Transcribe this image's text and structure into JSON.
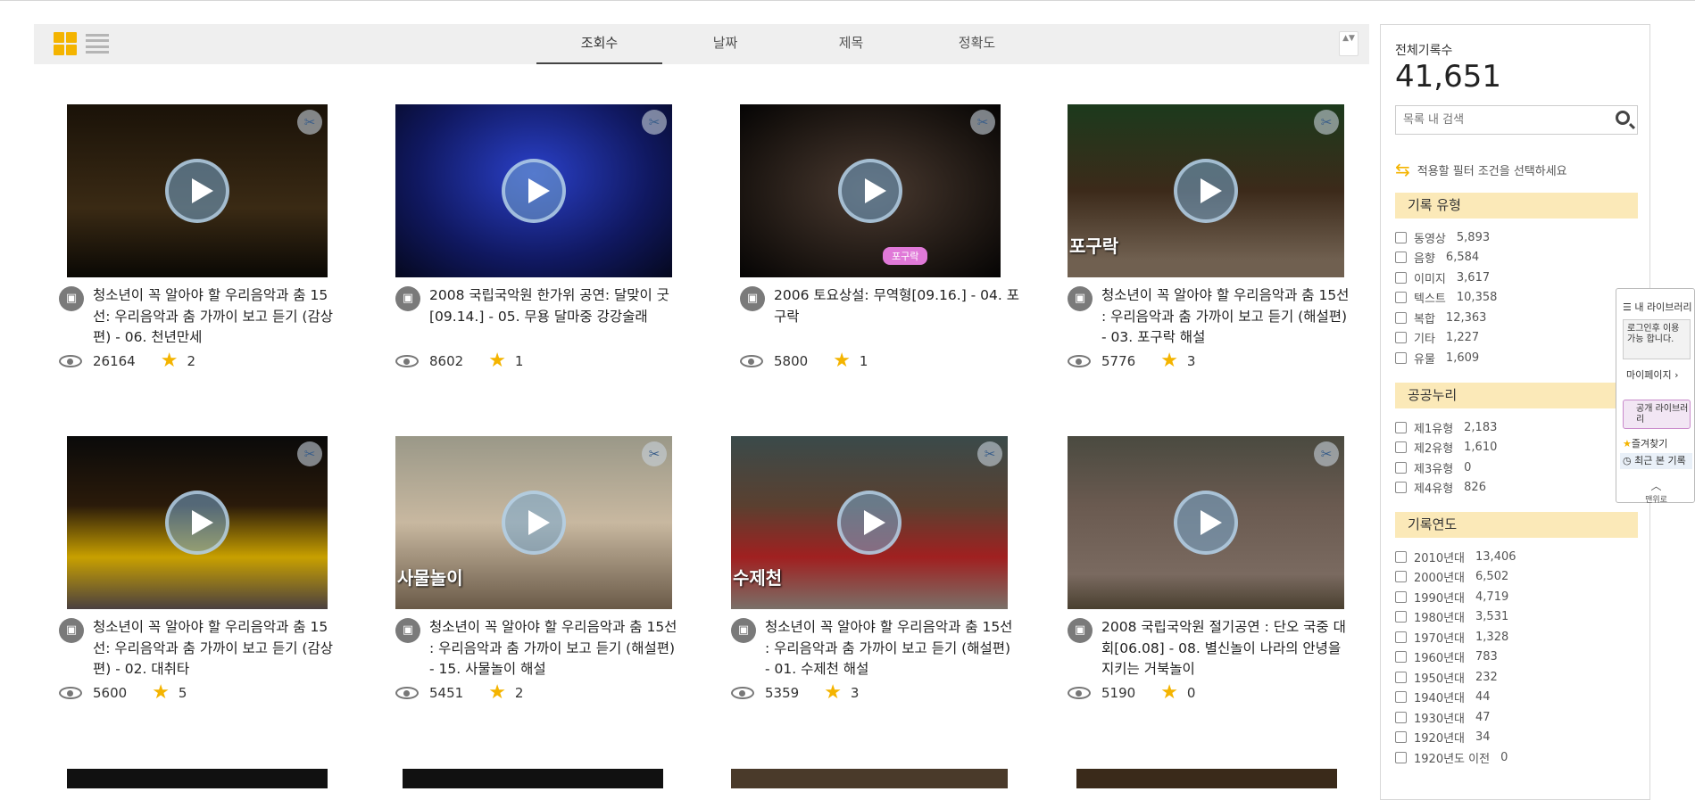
{
  "sort": {
    "tabs": [
      "조회수",
      "날짜",
      "제목",
      "정확도"
    ],
    "active": 0,
    "arrows": "▲▼"
  },
  "cards": [
    {
      "title": "청소년이 꼭 알아야 할 우리음악과 춤 15선: 우리음악과 춤 가까이 보고 듣기 (감상편) - 06. 천년만세",
      "views": "26164",
      "stars": "2",
      "overlay": ""
    },
    {
      "title": "2008 국립국악원 한가위 공연: 달맞이 굿[09.14.] - 05. 무용 달마중 강강술래",
      "views": "8602",
      "stars": "1",
      "overlay": ""
    },
    {
      "title": "2006 토요상설: 무역형[09.16.] - 04. 포구락",
      "views": "5800",
      "stars": "1",
      "overlay": ""
    },
    {
      "title": "청소년이 꼭 알아야 할 우리음악과 춤 15선 : 우리음악과 춤 가까이 보고 듣기 (해설편) - 03. 포구락 해설",
      "views": "5776",
      "stars": "3",
      "overlay": "포구락"
    },
    {
      "title": "청소년이 꼭 알아야 할 우리음악과 춤 15선: 우리음악과 춤 가까이 보고 듣기 (감상편) - 02. 대취타",
      "views": "5600",
      "stars": "5",
      "overlay": ""
    },
    {
      "title": "청소년이 꼭 알아야 할 우리음악과 춤 15선 : 우리음악과 춤 가까이 보고 듣기 (해설편) - 15. 사물놀이 해설",
      "views": "5451",
      "stars": "2",
      "overlay": "사물놀이"
    },
    {
      "title": "청소년이 꼭 알아야 할 우리음악과 춤 15선 : 우리음악과 춤 가까이 보고 듣기 (해설편) - 01. 수제천 해설",
      "views": "5359",
      "stars": "3",
      "overlay": "수제천"
    },
    {
      "title": "2008 국립국악원 절기공연 : 단오 국중 대회[06.08] - 08. 별신놀이 나라의 안녕을 지키는 거북놀이",
      "views": "5190",
      "stars": "0",
      "overlay": ""
    }
  ],
  "thumb_badge": "포구락",
  "sidebar": {
    "total_label": "전체기록수",
    "total_count": "41,651",
    "search_placeholder": "목록 내 검색",
    "filter_hint": "적용할 필터 조건을 선택하세요",
    "sections": [
      {
        "title": "기록 유형",
        "options": [
          {
            "label": "동영상",
            "count": "5,893"
          },
          {
            "label": "음향",
            "count": "6,584"
          },
          {
            "label": "이미지",
            "count": "3,617"
          },
          {
            "label": "텍스트",
            "count": "10,358"
          },
          {
            "label": "복합",
            "count": "12,363"
          },
          {
            "label": "기타",
            "count": "1,227"
          },
          {
            "label": "유물",
            "count": "1,609"
          }
        ]
      },
      {
        "title": "공공누리",
        "options": [
          {
            "label": "제1유형",
            "count": "2,183"
          },
          {
            "label": "제2유형",
            "count": "1,610"
          },
          {
            "label": "제3유형",
            "count": "0"
          },
          {
            "label": "제4유형",
            "count": "826"
          }
        ]
      },
      {
        "title": "기록연도",
        "options": [
          {
            "label": "2010년대",
            "count": "13,406"
          },
          {
            "label": "2000년대",
            "count": "6,502"
          },
          {
            "label": "1990년대",
            "count": "4,719"
          },
          {
            "label": "1980년대",
            "count": "3,531"
          },
          {
            "label": "1970년대",
            "count": "1,328"
          },
          {
            "label": "1960년대",
            "count": "783"
          },
          {
            "label": "1950년대",
            "count": "232"
          },
          {
            "label": "1940년대",
            "count": "44"
          },
          {
            "label": "1930년대",
            "count": "47"
          },
          {
            "label": "1920년대",
            "count": "34"
          },
          {
            "label": "1920년도 이전",
            "count": "0"
          }
        ]
      }
    ]
  },
  "float_panel": {
    "my_library": "내 라이브러리",
    "login_msg": "로그인후 이용가능 합니다.",
    "mypage": "마이페이지",
    "public_library": "공개 라이브러리",
    "favorites": "즐겨찾기",
    "recent": "최근 본 기록",
    "top": "맨위로"
  },
  "icons": {
    "grid_view": "grid-icon",
    "list_view": "list-icon",
    "type": "video-camera-icon",
    "views": "eye-icon",
    "rating": "star-icon",
    "clip": "scissors-icon",
    "search": "search-icon",
    "filter": "swap-arrows-icon"
  },
  "colors": {
    "accent": "#f4b400",
    "section_bg": "#fbe9b8"
  }
}
